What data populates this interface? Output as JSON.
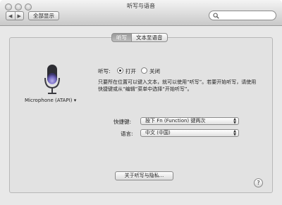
{
  "window": {
    "title": "听写与语音"
  },
  "toolbar": {
    "back_label": "◀",
    "forward_label": "▶",
    "show_all_label": "全部显示",
    "search_value": ""
  },
  "tabs": [
    {
      "label": "听写",
      "selected": true
    },
    {
      "label": "文本至语音",
      "selected": false
    }
  ],
  "dictation": {
    "microphone_label": "Microphone (ATAPI)",
    "microphone_menu_glyph": "▾",
    "mode_label": "听写:",
    "on_label": "打开",
    "off_label": "关闭",
    "selected_mode": "on",
    "description": "只要所在位置可以键入文本，就可以使用“听写”。若要开始听写，请使用快捷键或从“编辑”菜单中选择“开始听写”。",
    "shortcut_label": "快捷键:",
    "shortcut_value": "按下 Fn (Function) 键两次",
    "language_label": "语言:",
    "language_value": "中文 (中国)",
    "about_button": "关于听写与隐私...",
    "help_glyph": "?"
  },
  "colors": {
    "mic_accent": "#7b6fd0",
    "window_bg": "#e8e8e8"
  }
}
